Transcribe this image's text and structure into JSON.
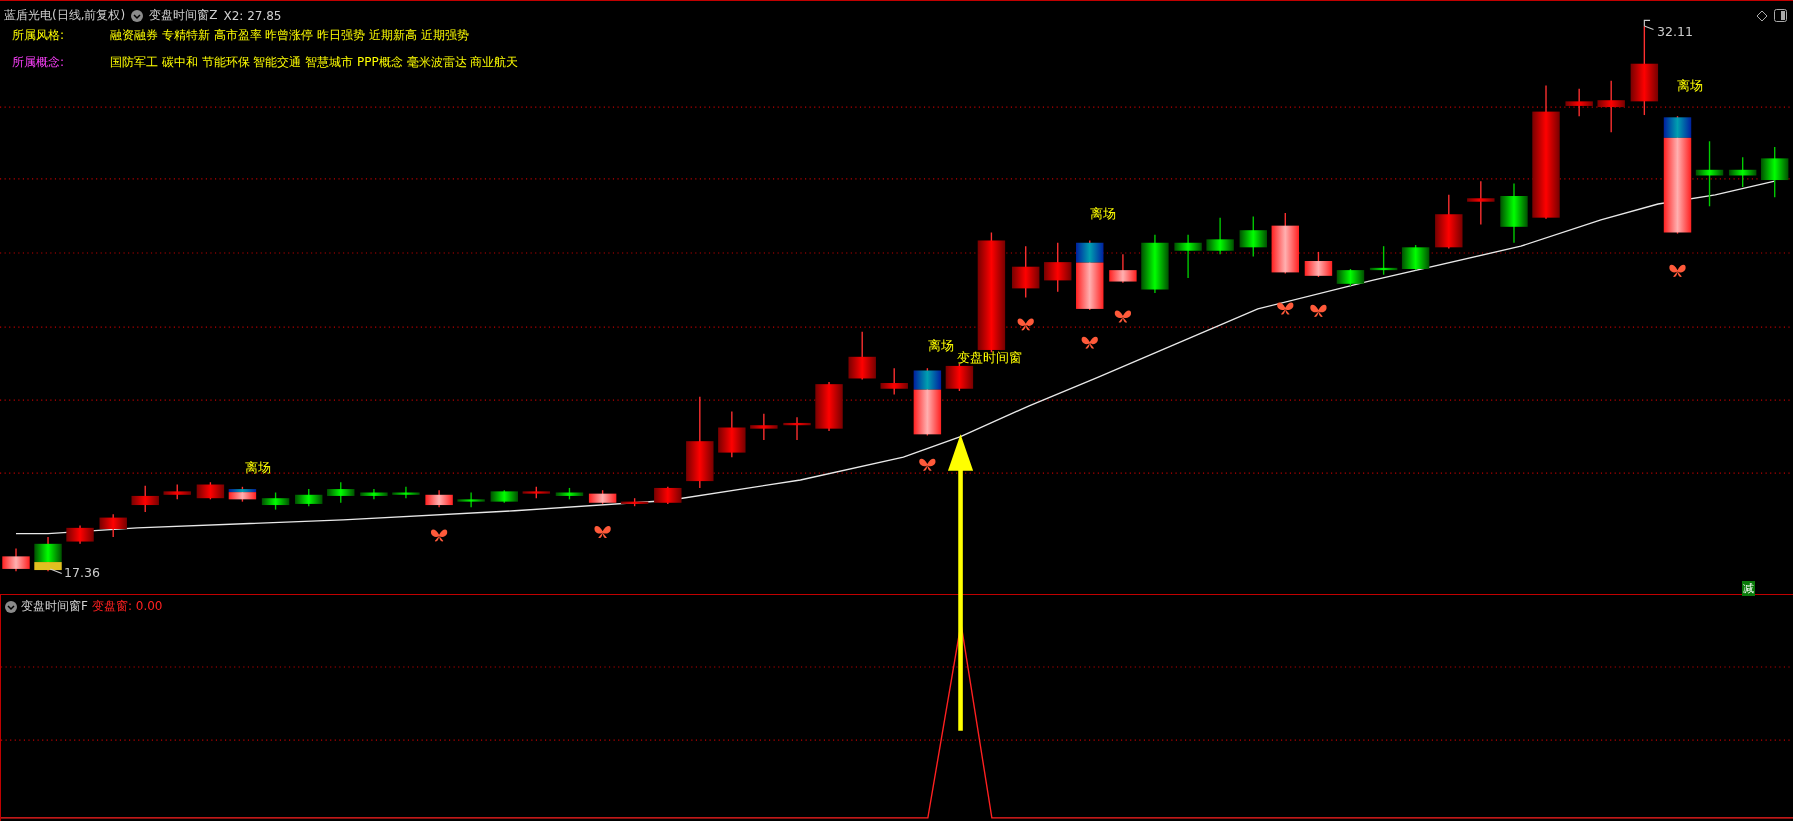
{
  "header": {
    "title": "蓝盾光电(日线,前复权)",
    "indicator": "变盘时间窗Z",
    "reading": "X2: 27.85"
  },
  "info": [
    {
      "label": "所属风格:",
      "value": "融资融券 专精特新 高市盈率 昨曾涨停 昨日强势 近期新高 近期强势",
      "kind": "style"
    },
    {
      "label": "所属概念:",
      "value": "国防军工 碳中和 节能环保 智能交通 智慧城市 PPP概念 毫米波雷达 商业航天",
      "kind": "concept"
    }
  ],
  "chart": {
    "exit_labels": [
      "离场",
      "离场",
      "离场",
      "离场"
    ],
    "signal_label": "变盘时间窗",
    "high_label": "32.11",
    "low_label": "17.36",
    "badge": "减"
  },
  "lower_panel": {
    "title": "变盘时间窗F",
    "reading": "变盘窗: 0.00"
  }
}
